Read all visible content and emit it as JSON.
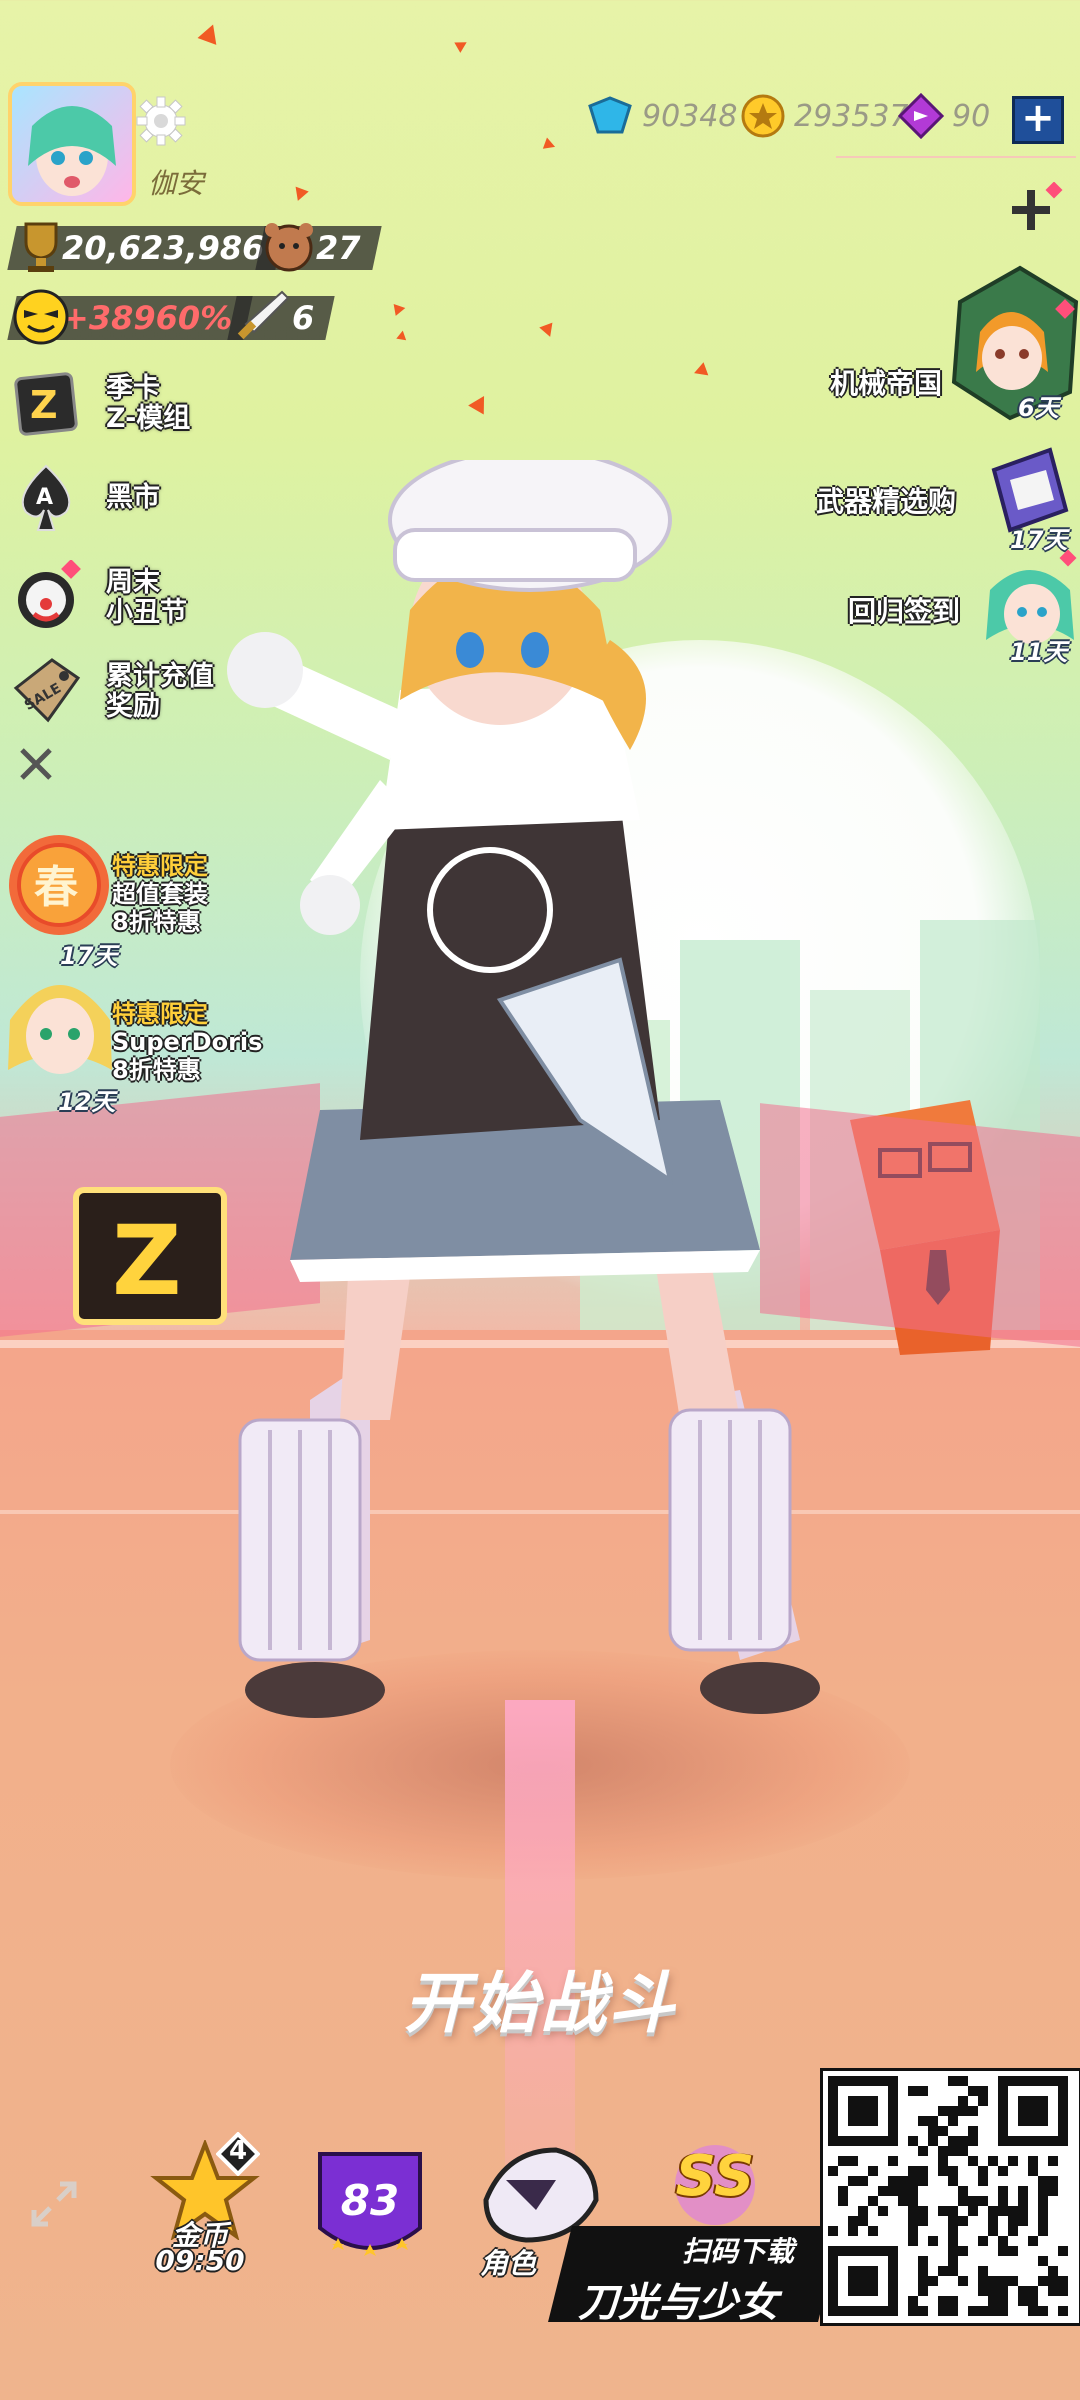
{
  "player": {
    "name": "伽安"
  },
  "stats": {
    "trophies": "20,623,986",
    "bear_count": "27",
    "bonus": "+38960%",
    "swords": "6"
  },
  "currency": {
    "gems": "90348",
    "coins": "293537",
    "tickets": "90",
    "add_label": "+"
  },
  "left_menu": [
    {
      "label": "季卡\nZ-模组",
      "icon": "z-card-icon"
    },
    {
      "label": "黑市",
      "icon": "spade-ace-icon"
    },
    {
      "label": "周末\n小丑节",
      "icon": "clown-icon"
    },
    {
      "label": "累计充值\n奖励",
      "icon": "sale-tag-icon"
    }
  ],
  "promos": [
    {
      "line1": "特惠限定",
      "line2": "超值套装",
      "line3": "8折特惠",
      "days": "17天"
    },
    {
      "line1": "特惠限定",
      "line2": "SuperDoris",
      "line3": "8折特惠",
      "days": "12天"
    }
  ],
  "right_events": [
    {
      "label": "机械帝国",
      "days": "6天"
    },
    {
      "label": "武器精选购",
      "days": "17天"
    },
    {
      "label": "回归签到",
      "days": "11天"
    }
  ],
  "start_button": "开始战斗",
  "bottom": {
    "coin_badge": "4",
    "coin_label": "金币",
    "coin_timer": "09:50",
    "level": "83",
    "role_label": "角色",
    "rank": "SS"
  },
  "ad": {
    "line1": "扫码下载",
    "line2": "刀光与少女"
  },
  "colors": {
    "accent_yellow": "#ffcf3a",
    "bonus_red": "#ff6b6b",
    "level_purple": "#7b2fd3",
    "currency_blue": "#1f4f9a"
  }
}
